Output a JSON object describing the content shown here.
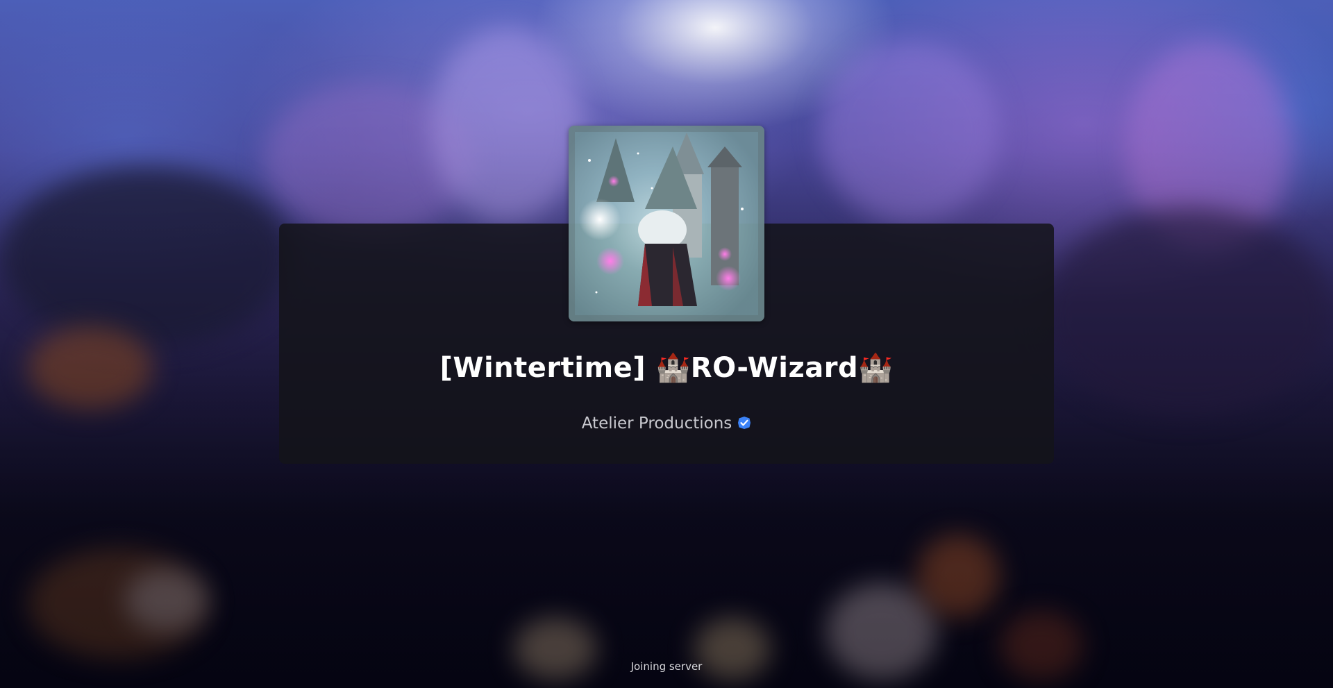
{
  "experience": {
    "title": "[Wintertime] 🏰RO-Wizard🏰",
    "creator": "Atelier Productions",
    "creator_verified_icon": "verified-badge-icon",
    "thumbnail_icon": "game-thumbnail-wizard"
  },
  "status": {
    "text": "Joining server"
  },
  "colors": {
    "card_background": "#14141a",
    "title_text": "#ffffff",
    "creator_text": "#c9c9cf",
    "verified_badge": "#3b82f6"
  }
}
